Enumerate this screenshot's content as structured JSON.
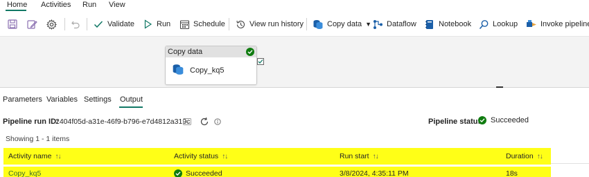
{
  "menu": {
    "tabs": [
      {
        "label": "Home"
      },
      {
        "label": "Activities"
      },
      {
        "label": "Run"
      },
      {
        "label": "View"
      }
    ]
  },
  "toolbar": {
    "validate_label": "Validate",
    "run_label": "Run",
    "schedule_label": "Schedule",
    "view_run_history_label": "View run history",
    "copy_data_label": "Copy data",
    "dataflow_label": "Dataflow",
    "notebook_label": "Notebook",
    "lookup_label": "Lookup",
    "invoke_pipeline_label": "Invoke pipeline"
  },
  "canvas": {
    "activity": {
      "type_label": "Copy data",
      "name": "Copy_kq5"
    }
  },
  "output_tabs": {
    "tabs": [
      {
        "label": "Parameters"
      },
      {
        "label": "Variables"
      },
      {
        "label": "Settings"
      },
      {
        "label": "Output"
      }
    ],
    "active": "Output"
  },
  "run_info": {
    "run_id_label": "Pipeline run ID:",
    "run_id": "2404f05d-a31e-46f9-b796-e7d4812a319c",
    "status_label": "Pipeline status",
    "status": "Succeeded"
  },
  "showing_text": "Showing 1 - 1 items",
  "table": {
    "columns": [
      {
        "label": "Activity name"
      },
      {
        "label": "Activity status"
      },
      {
        "label": "Run start"
      },
      {
        "label": "Duration"
      }
    ],
    "rows": [
      {
        "activity_name": "Copy_kq5",
        "activity_status": "Succeeded",
        "run_start": "3/8/2024, 4:35:11 PM",
        "duration": "18s"
      }
    ]
  },
  "colors": {
    "accent": "#117865",
    "success": "#107c10",
    "highlight": "#ffff17"
  }
}
